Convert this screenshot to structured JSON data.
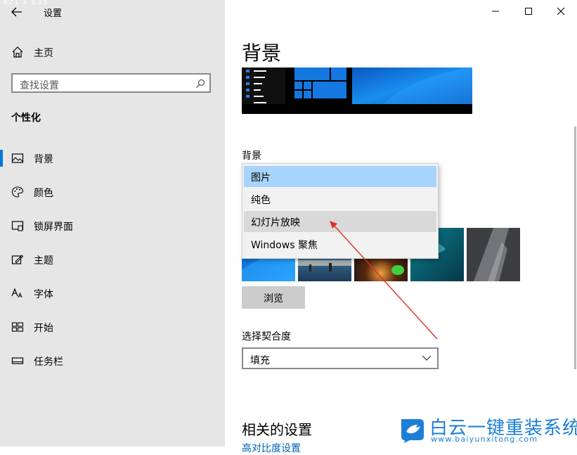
{
  "window": {
    "dimension_label": "821 x 635",
    "title": "设置",
    "controls": {
      "minimize": "minimize-icon",
      "maximize": "maximize-icon",
      "close": "close-icon"
    }
  },
  "sidebar": {
    "home_label": "主页",
    "search_placeholder": "查找设置",
    "section_title": "个性化",
    "items": [
      {
        "label": "背景",
        "icon": "picture-icon",
        "active": true
      },
      {
        "label": "颜色",
        "icon": "palette-icon",
        "active": false
      },
      {
        "label": "锁屏界面",
        "icon": "lock-screen-icon",
        "active": false
      },
      {
        "label": "主题",
        "icon": "theme-icon",
        "active": false
      },
      {
        "label": "字体",
        "icon": "font-icon",
        "active": false
      },
      {
        "label": "开始",
        "icon": "start-icon",
        "active": false
      },
      {
        "label": "任务栏",
        "icon": "taskbar-icon",
        "active": false
      }
    ]
  },
  "main": {
    "page_title": "背景",
    "background_label": "背景",
    "background_options": [
      {
        "label": "图片",
        "state": "selected"
      },
      {
        "label": "纯色",
        "state": "normal"
      },
      {
        "label": "幻灯片放映",
        "state": "hover"
      },
      {
        "label": "Windows 聚焦",
        "state": "normal"
      }
    ],
    "browse_label": "浏览",
    "fit_label": "选择契合度",
    "fit_value": "填充",
    "related_title": "相关的设置",
    "related_link": "高对比度设置"
  },
  "watermark": {
    "title": "白云一键重装系统",
    "url": "www.baiyunxitong.com"
  },
  "colors": {
    "accent": "#0078d7",
    "selected": "#a8d3fb",
    "annotation": "#e0302a"
  }
}
